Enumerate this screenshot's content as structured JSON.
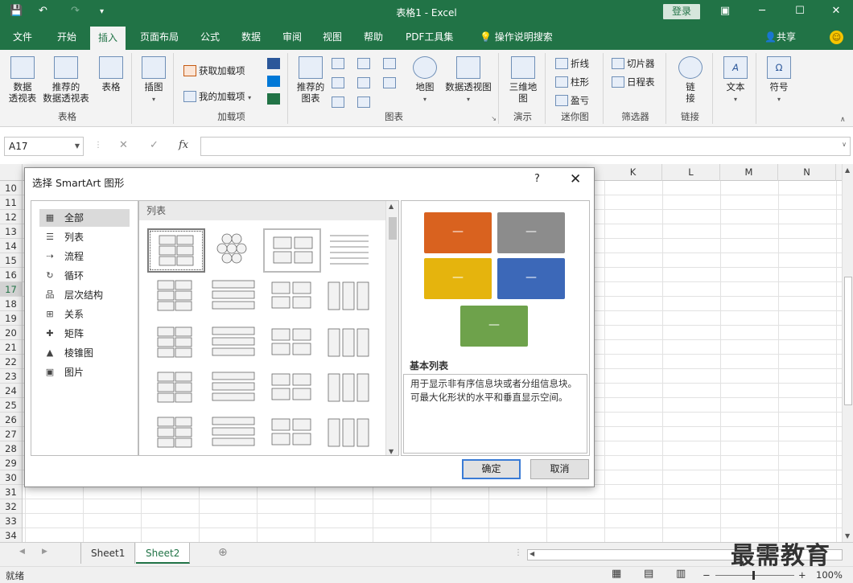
{
  "window": {
    "title": "表格1 - Excel",
    "login_label": "登录",
    "share_label": "共享"
  },
  "ribbon_tabs": [
    "文件",
    "开始",
    "插入",
    "页面布局",
    "公式",
    "数据",
    "审阅",
    "视图",
    "帮助",
    "PDF工具集"
  ],
  "ribbon_search": "操作说明搜索",
  "active_tab": "插入",
  "ribbon": {
    "tables": {
      "label": "表格",
      "pivot": "数据\n透视表",
      "recommended_pivot": "推荐的\n数据透视表",
      "table": "表格"
    },
    "illustrations": {
      "label": "插图"
    },
    "addins": {
      "label": "加载项",
      "get": "获取加载项",
      "mine": "我的加载项"
    },
    "charts": {
      "label": "图表",
      "recommended": "推荐的\n图表",
      "map": "地图",
      "pivotchart": "数据透视图"
    },
    "tours": {
      "label": "演示",
      "map3d": "三维地\n图"
    },
    "sparklines": {
      "label": "迷你图",
      "line": "折线",
      "column": "柱形",
      "winloss": "盈亏"
    },
    "filters": {
      "label": "筛选器",
      "slicer": "切片器",
      "timeline": "日程表"
    },
    "links": {
      "label": "链接",
      "link": "链\n接"
    },
    "text": {
      "label": "文本"
    },
    "symbols": {
      "label": "符号"
    }
  },
  "formula_bar": {
    "name_box": "A17",
    "cancel": "✕",
    "enter": "✓",
    "fx": "fx"
  },
  "grid": {
    "columns": [
      "K",
      "L",
      "M",
      "N"
    ],
    "rows": [
      "10",
      "11",
      "12",
      "13",
      "14",
      "15",
      "16",
      "17",
      "18",
      "19",
      "20",
      "21",
      "22",
      "23",
      "24",
      "25",
      "26",
      "27",
      "28",
      "29",
      "30",
      "31",
      "32",
      "33",
      "34"
    ],
    "selected_row": "17"
  },
  "sheets": [
    "Sheet1",
    "Sheet2"
  ],
  "active_sheet": "Sheet2",
  "status": {
    "ready": "就绪",
    "zoom": "100%",
    "zoom_out": "−",
    "zoom_in": "+"
  },
  "watermark": "最需教育",
  "dialog": {
    "title": "选择 SmartArt 图形",
    "help": "?",
    "close": "✕",
    "categories": [
      {
        "label": "全部",
        "icon": "all-icon",
        "selected": true
      },
      {
        "label": "列表",
        "icon": "list-icon"
      },
      {
        "label": "流程",
        "icon": "process-icon"
      },
      {
        "label": "循环",
        "icon": "cycle-icon"
      },
      {
        "label": "层次结构",
        "icon": "hierarchy-icon"
      },
      {
        "label": "关系",
        "icon": "relationship-icon"
      },
      {
        "label": "矩阵",
        "icon": "matrix-icon"
      },
      {
        "label": "棱锥图",
        "icon": "pyramid-icon"
      },
      {
        "label": "图片",
        "icon": "picture-icon"
      }
    ],
    "layout_header": "列表",
    "preview_title": "基本列表",
    "preview_desc": "用于显示非有序信息块或者分组信息块。可最大化形状的水平和垂直显示空间。",
    "preview_boxes": [
      {
        "text": "—",
        "color": "#d9621f"
      },
      {
        "text": "—",
        "color": "#8c8c8c"
      },
      {
        "text": "—",
        "color": "#e5b40d"
      },
      {
        "text": "—",
        "color": "#3c68b8"
      },
      {
        "text": "—",
        "color": "#6ea24b"
      }
    ],
    "ok_label": "确定",
    "cancel_label": "取消"
  }
}
